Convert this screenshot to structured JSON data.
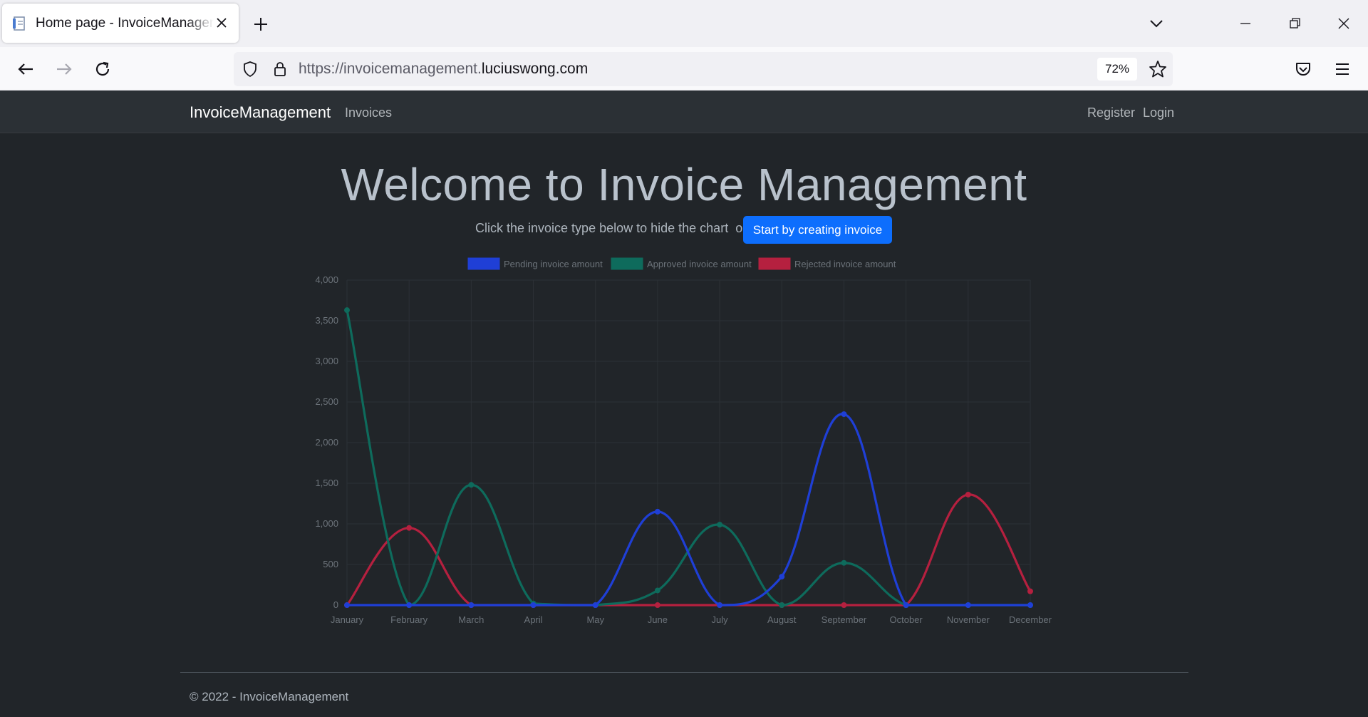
{
  "browser": {
    "tab_title": "Home page - InvoiceManagement",
    "url_prefix": "https://invoicemanagement.",
    "url_host": "luciuswong.com",
    "zoom": "72%"
  },
  "site_nav": {
    "brand": "InvoiceManagement",
    "links": [
      "Invoices"
    ],
    "right_links": [
      "Register",
      "Login"
    ]
  },
  "hero": {
    "title": "Welcome to Invoice Management",
    "subtitle": "Click the invoice type below to hide the chart  or",
    "cta_label": "Start by creating invoice"
  },
  "chart_data": {
    "type": "line",
    "categories": [
      "January",
      "February",
      "March",
      "April",
      "May",
      "June",
      "July",
      "August",
      "September",
      "October",
      "November",
      "December"
    ],
    "series": [
      {
        "name": "Pending invoice amount",
        "color": "#1f3fd6",
        "values": [
          0,
          0,
          0,
          0,
          0,
          1150,
          0,
          350,
          2350,
          0,
          0,
          0
        ]
      },
      {
        "name": "Approved invoice amount",
        "color": "#0e6b5c",
        "values": [
          3630,
          0,
          1480,
          20,
          0,
          180,
          990,
          0,
          520,
          0,
          0,
          0
        ]
      },
      {
        "name": "Rejected invoice amount",
        "color": "#b5203f",
        "values": [
          0,
          950,
          0,
          0,
          0,
          0,
          0,
          0,
          0,
          0,
          1360,
          170
        ]
      }
    ],
    "ylim": [
      0,
      4000
    ],
    "yticks": [
      "0",
      "500",
      "1,000",
      "1,500",
      "2,000",
      "2,500",
      "3,000",
      "3,500",
      "4,000"
    ],
    "grid": true,
    "legend": "top"
  },
  "footer": {
    "text": "© 2022 - InvoiceManagement"
  }
}
